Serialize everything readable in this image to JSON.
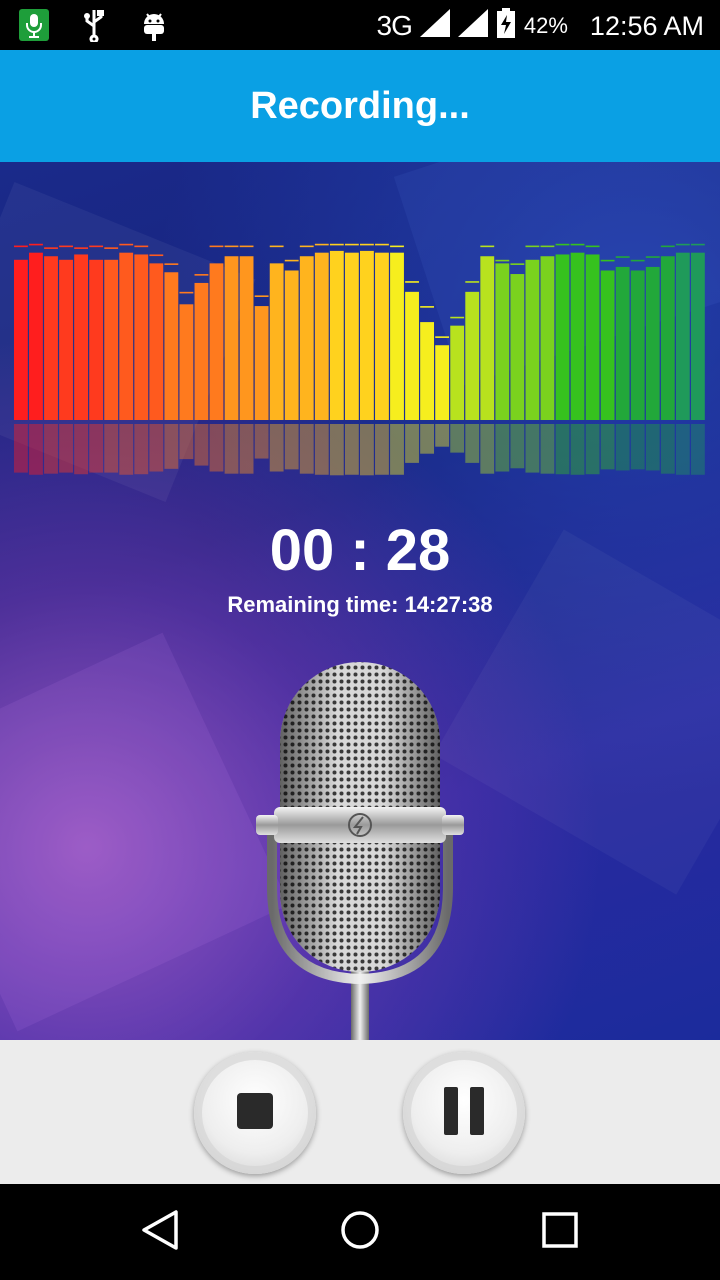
{
  "status_bar": {
    "network": "3G",
    "battery": "42%",
    "time": "12:56 AM",
    "left_icons": [
      "microphone-notification-icon",
      "usb-icon",
      "android-debug-icon"
    ]
  },
  "app_bar": {
    "title": "Recording..."
  },
  "recorder": {
    "elapsed": "00 : 28",
    "remaining": "Remaining time: 14:27:38"
  },
  "spectrum": {
    "levels": [
      0.9,
      0.94,
      0.92,
      0.9,
      0.93,
      0.9,
      0.9,
      0.94,
      0.93,
      0.88,
      0.83,
      0.65,
      0.77,
      0.88,
      0.92,
      0.92,
      0.64,
      0.88,
      0.84,
      0.92,
      0.94,
      0.95,
      0.94,
      0.95,
      0.94,
      0.94,
      0.72,
      0.55,
      0.42,
      0.53,
      0.72,
      0.92,
      0.88,
      0.82,
      0.9,
      0.92,
      0.93,
      0.94,
      0.93,
      0.84,
      0.86,
      0.84,
      0.86,
      0.92,
      0.94,
      0.94
    ],
    "peaks": [
      0.98,
      0.99,
      0.97,
      0.98,
      0.97,
      0.98,
      0.97,
      0.99,
      0.98,
      0.93,
      0.88,
      0.72,
      0.82,
      0.98,
      0.98,
      0.98,
      0.7,
      0.98,
      0.9,
      0.98,
      0.99,
      0.99,
      0.99,
      0.99,
      0.99,
      0.98,
      0.78,
      0.64,
      0.47,
      0.58,
      0.78,
      0.98,
      0.9,
      0.88,
      0.98,
      0.98,
      0.99,
      0.99,
      0.98,
      0.9,
      0.92,
      0.9,
      0.92,
      0.98,
      0.99,
      0.99
    ],
    "colors": [
      "#ff1e1e",
      "#ff3a1e",
      "#ff5a1e",
      "#ff7a1e",
      "#ff961e",
      "#ffb41e",
      "#ffd21e",
      "#f6ee1e",
      "#b8e21e",
      "#7ad21e",
      "#36c21e",
      "#22a83a",
      "#1f9a5a"
    ]
  },
  "controls": {
    "stop_icon": "stop-icon",
    "pause_icon": "pause-icon"
  },
  "nav": {
    "back_icon": "back-icon",
    "home_icon": "home-icon",
    "recents_icon": "recents-icon"
  }
}
